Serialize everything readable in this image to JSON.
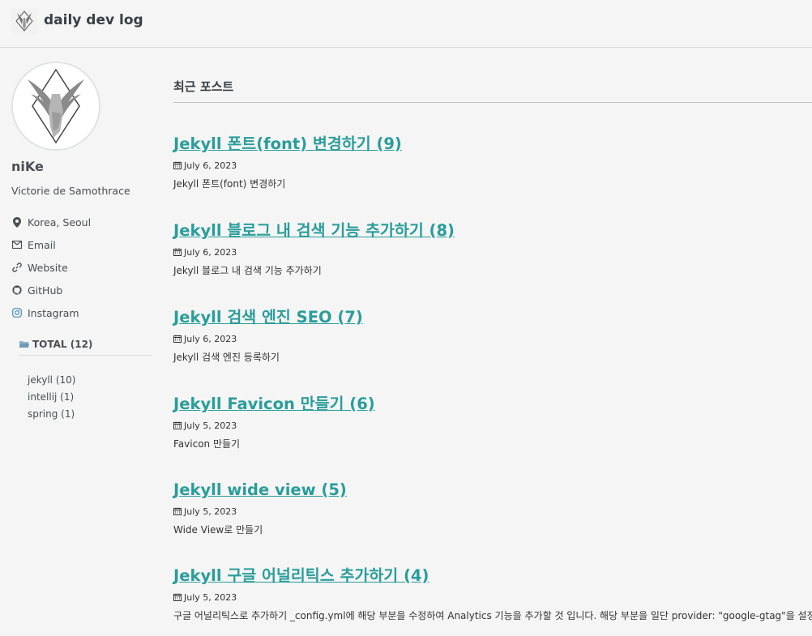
{
  "header": {
    "site_title": "daily dev log"
  },
  "author": {
    "name": "niKe",
    "bio": "Victorie de Samothrace",
    "links": [
      {
        "icon": "map-marker-icon",
        "label": "Korea, Seoul",
        "clickable": false
      },
      {
        "icon": "envelope-icon",
        "label": "Email",
        "clickable": true
      },
      {
        "icon": "link-icon",
        "label": "Website",
        "clickable": true
      },
      {
        "icon": "github-icon",
        "label": "GitHub",
        "clickable": true
      },
      {
        "icon": "instagram-icon",
        "label": "Instagram",
        "clickable": true
      }
    ]
  },
  "categories": {
    "total_label": "TOTAL (12)",
    "items": [
      {
        "label": "jekyll (10)"
      },
      {
        "label": "intellij (1)"
      },
      {
        "label": "spring (1)"
      }
    ]
  },
  "main": {
    "section_title": "최근 포스트",
    "posts": [
      {
        "title": "Jekyll 폰트(font) 변경하기 (9)",
        "date": "July 6, 2023",
        "excerpt": "Jekyll 폰트(font) 변경하기"
      },
      {
        "title": "Jekyll 블로그 내 검색 기능 추가하기 (8)",
        "date": "July 6, 2023",
        "excerpt": "Jekyll 블로그 내 검색 기능 추가하기"
      },
      {
        "title": "Jekyll 검색 엔진 SEO (7)",
        "date": "July 6, 2023",
        "excerpt": "Jekyll 검색 엔진 등록하기"
      },
      {
        "title": "Jekyll Favicon 만들기 (6)",
        "date": "July 5, 2023",
        "excerpt": "Favicon 만들기"
      },
      {
        "title": "Jekyll wide view (5)",
        "date": "July 5, 2023",
        "excerpt": "Wide View로 만들기"
      },
      {
        "title": "Jekyll 구글 어널리틱스 추가하기 (4)",
        "date": "July 5, 2023",
        "excerpt": "구글 어널리틱스로 추가하기 _config.yml에 해당 부분을 수정하여 Analytics 기능을 추가할 것 입니다. 해당 부분을 일단 provider: \"google-gtag\"을 설정해 둔다."
      }
    ]
  },
  "colors": {
    "accent": "#2a9d9b",
    "background": "#f4f5f4",
    "text": "#333333"
  }
}
